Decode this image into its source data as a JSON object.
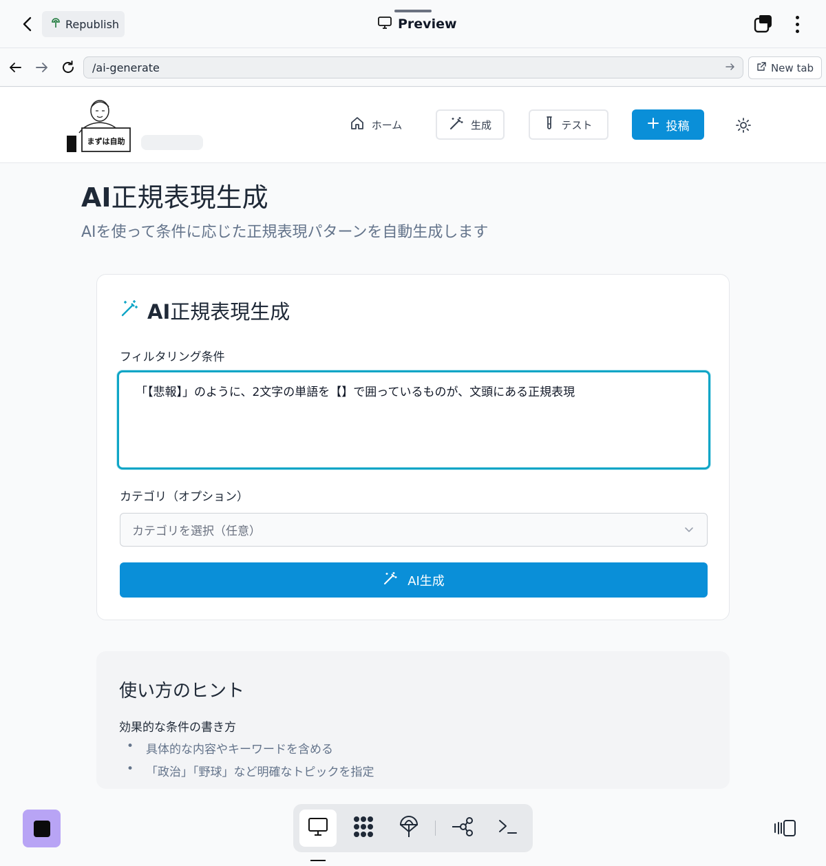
{
  "topbar": {
    "republish_label": "Republish",
    "title": "Preview"
  },
  "urlbar": {
    "url": "/ai-generate",
    "new_tab_label": "New tab"
  },
  "header": {
    "logo_text": "まずは自助",
    "nav": {
      "home": "ホーム",
      "generate": "生成",
      "test": "テスト",
      "post": "投稿"
    }
  },
  "page": {
    "title_bold": "AI",
    "title_rest": "正規表現生成",
    "subtitle": "AIを使って条件に応じた正規表現パターンを自動生成します"
  },
  "card": {
    "title_bold": "AI",
    "title_rest": "正規表現生成",
    "filter_label": "フィルタリング条件",
    "filter_value": "「【悲報】」のように、2文字の単語を【】で囲っているものが、文頭にある正規表現",
    "category_label": "カテゴリ（オプション）",
    "category_placeholder": "カテゴリを選択（任意）",
    "generate_button": "AI生成"
  },
  "hints": {
    "title": "使い方のヒント",
    "subtitle": "効果的な条件の書き方",
    "items": [
      "具体的な内容やキーワードを含める",
      "「政治」「野球」など明確なトピックを指定"
    ]
  },
  "colors": {
    "accent": "#0a8fd8",
    "focus_ring": "#0ea5c6",
    "stop_button": "#b8a4f5"
  }
}
